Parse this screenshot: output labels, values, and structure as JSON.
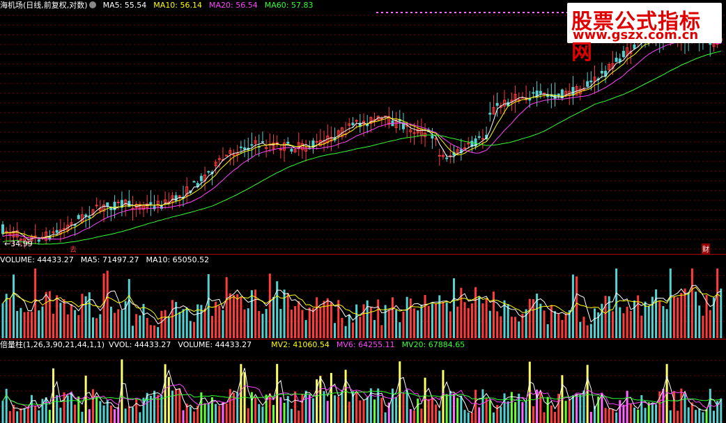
{
  "price": {
    "title": "海机场(日线,前复权,对数)",
    "ma5": "MA5: 55.54",
    "ma10": "MA10: 56.14",
    "ma20": "MA20: 56.54",
    "ma60": "MA60: 57.83",
    "low_label": "←34.99",
    "marker_left": "去",
    "marker_right": "财"
  },
  "volume": {
    "volume": "VOLUME: 44433.27",
    "ma5": "MA5: 71497.27",
    "ma10": "MA10: 65050.52"
  },
  "indicator": {
    "name": "倍量柱(1,26,3,90,21,44,1,1)",
    "vvol": "VVOL: 44433.27",
    "volume": "VOLUME: 44433.27",
    "mv2": "MV2: 41060.54",
    "mv6": "MV6: 64255.11",
    "mv20": "MV20: 67884.65"
  },
  "watermark": {
    "title": "股票公式指标网",
    "url": "www.gszx.com.cn"
  },
  "colors": {
    "up": "#ff3c3c",
    "down": "#54d2d2",
    "ma5": "#ffffff",
    "ma10": "#ffff00",
    "ma20": "#ff44ff",
    "ma60": "#33ff33",
    "grid": "#7a0000"
  }
}
